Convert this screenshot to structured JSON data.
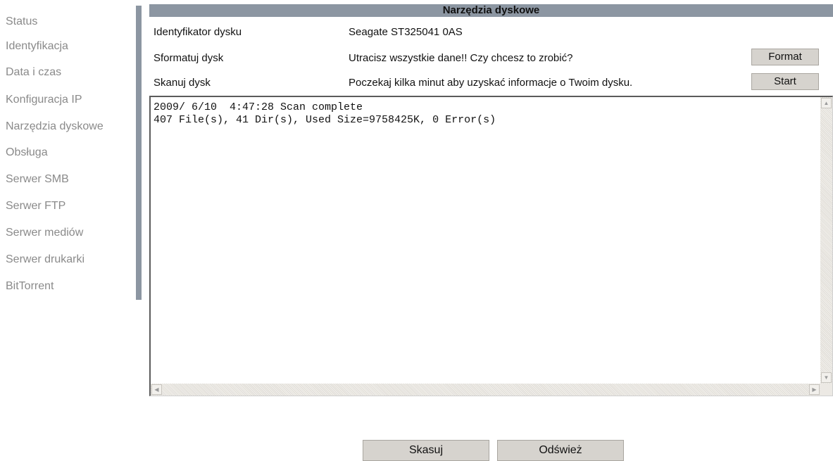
{
  "sidebar": {
    "items": [
      {
        "label": "Status"
      },
      {
        "label": "Identyfikacja"
      },
      {
        "label": "Data i czas"
      },
      {
        "label": "Konfiguracja IP"
      },
      {
        "label": "Narzędzia dyskowe"
      },
      {
        "label": "Obsługa"
      },
      {
        "label": "Serwer SMB"
      },
      {
        "label": "Serwer FTP"
      },
      {
        "label": "Serwer mediów"
      },
      {
        "label": "Serwer drukarki"
      },
      {
        "label": "BitTorrent"
      }
    ]
  },
  "main": {
    "title": "Narzędzia dyskowe",
    "rows": [
      {
        "label": "Identyfikator dysku",
        "value": "Seagate ST325041 0AS"
      },
      {
        "label": "Sformatuj dysk",
        "value": "Utracisz wszystkie dane!! Czy chcesz to zrobić?",
        "button": "Format"
      },
      {
        "label": "Skanuj dysk",
        "value": "Poczekaj kilka minut aby uzyskać informacje o Twoim dysku.",
        "button": "Start"
      }
    ],
    "log": {
      "lines": [
        "2009/ 6/10  4:47:28 Scan complete",
        "407 File(s), 41 Dir(s), Used Size=9758425K, 0 Error(s)"
      ]
    }
  },
  "footer": {
    "reset_label": "Skasuj",
    "refresh_label": "Odśwież"
  },
  "colors": {
    "header_bar": "#8c96a2",
    "button_face": "#d6d3ce",
    "sidebar_text": "#8a8a8a"
  }
}
